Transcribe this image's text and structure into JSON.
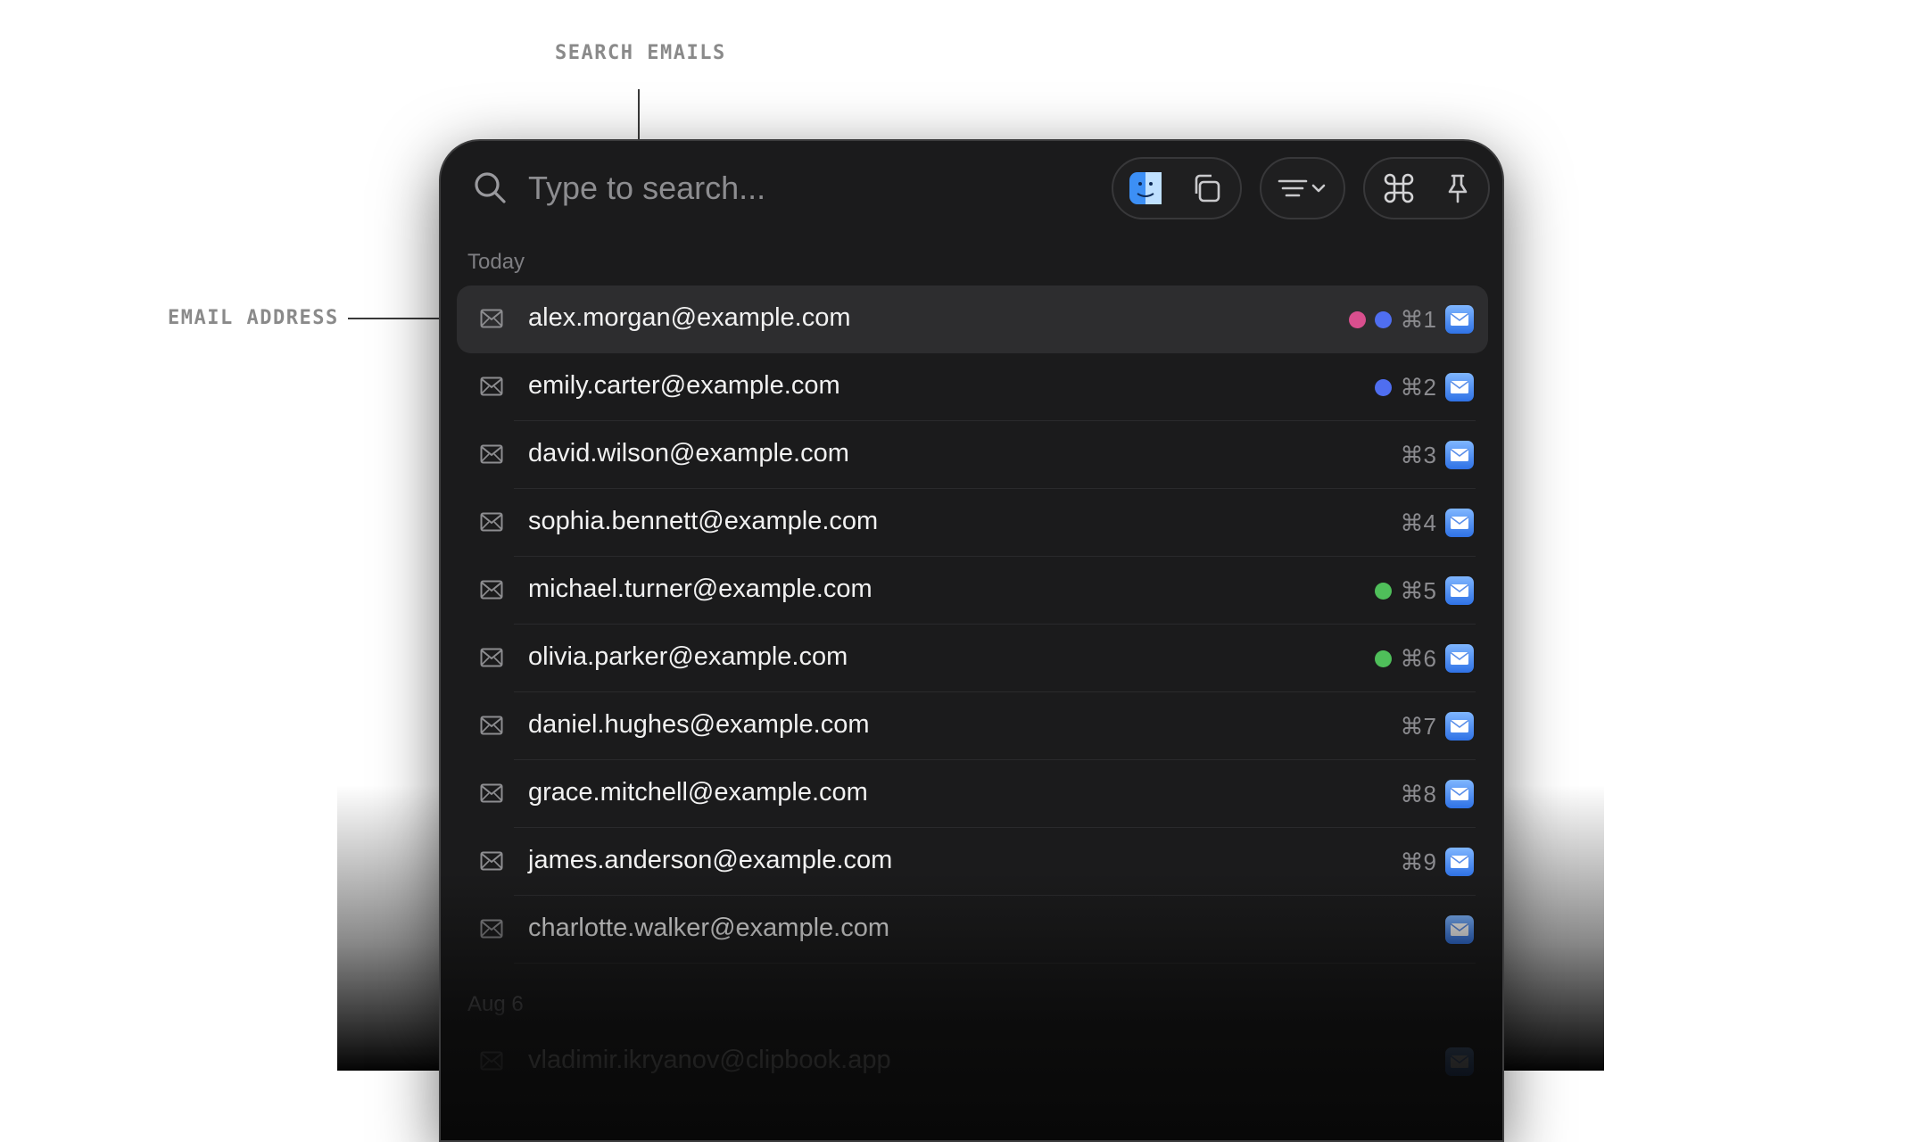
{
  "callouts": {
    "search": "SEARCH EMAILS",
    "email": "EMAIL ADDRESS"
  },
  "search": {
    "placeholder": "Type to search..."
  },
  "toolbar": {
    "icons": [
      "finder-icon",
      "copy-icon",
      "filter-icon",
      "chevron-down-icon",
      "command-icon",
      "pin-icon"
    ]
  },
  "sections": [
    {
      "label": "Today",
      "items": [
        {
          "email": "alex.morgan@example.com",
          "tags": [
            "#d94f8e",
            "#4f6ef0"
          ],
          "shortcut": "⌘1",
          "selected": true
        },
        {
          "email": "emily.carter@example.com",
          "tags": [
            "#4f6ef0"
          ],
          "shortcut": "⌘2"
        },
        {
          "email": "david.wilson@example.com",
          "tags": [],
          "shortcut": "⌘3"
        },
        {
          "email": "sophia.bennett@example.com",
          "tags": [],
          "shortcut": "⌘4"
        },
        {
          "email": "michael.turner@example.com",
          "tags": [
            "#4fbf5a"
          ],
          "shortcut": "⌘5"
        },
        {
          "email": "olivia.parker@example.com",
          "tags": [
            "#4fbf5a"
          ],
          "shortcut": "⌘6"
        },
        {
          "email": "daniel.hughes@example.com",
          "tags": [],
          "shortcut": "⌘7"
        },
        {
          "email": "grace.mitchell@example.com",
          "tags": [],
          "shortcut": "⌘8"
        },
        {
          "email": "james.anderson@example.com",
          "tags": [],
          "shortcut": "⌘9"
        },
        {
          "email": "charlotte.walker@example.com",
          "tags": [],
          "shortcut": ""
        }
      ]
    },
    {
      "label": "Aug 6",
      "items": [
        {
          "email": "vladimir.ikryanov@clipbook.app",
          "tags": [],
          "shortcut": ""
        }
      ]
    }
  ],
  "colors": {
    "window_bg": "#1b1b1c",
    "selected_row": "#2d2d2f",
    "accent_blue": "#4f6ef0"
  }
}
